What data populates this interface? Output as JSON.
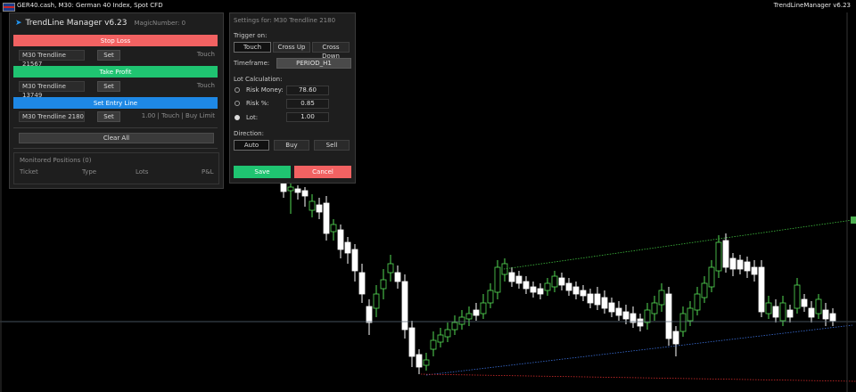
{
  "topbar": {
    "symbol": "GER40.cash, M30:  German 40 Index, Spot CFD",
    "version": "TrendLineManager v6.23"
  },
  "manager": {
    "title": "TrendLine Manager v6.23",
    "magic": "MagicNumber: 0",
    "stop_loss": {
      "label": "Stop Loss",
      "line": "M30 Trendline 21567",
      "set": "Set",
      "mode": "Touch",
      "color": "#f26262"
    },
    "take_profit": {
      "label": "Take Profit",
      "line": "M30 Trendline 13749",
      "set": "Set",
      "mode": "Touch",
      "color": "#1fc471"
    },
    "entry": {
      "label": "Set Entry Line",
      "line": "M30 Trendline 2180",
      "set": "Set",
      "info": "1.00 | Touch | Buy Limit",
      "color": "#1e88e5"
    },
    "clear_all": "Clear All",
    "monitored": {
      "title": "Monitored Positions (0)",
      "columns": [
        "Ticket",
        "Type",
        "Lots",
        "P&L"
      ]
    }
  },
  "settings": {
    "title": "Settings for: M30 Trendline 2180",
    "trigger_label": "Trigger on:",
    "triggers": [
      "Touch",
      "Cross Up",
      "Cross Down"
    ],
    "trigger_selected": 0,
    "timeframe_label": "Timeframe:",
    "timeframe": "PERIOD_H1",
    "lot_label": "Lot Calculation:",
    "lot_options": [
      {
        "label": "Risk Money:",
        "value": "78.60"
      },
      {
        "label": "Risk %:",
        "value": "0.85"
      },
      {
        "label": "Lot:",
        "value": "1.00"
      }
    ],
    "lot_selected": 2,
    "direction_label": "Direction:",
    "directions": [
      "Auto",
      "Buy",
      "Sell"
    ],
    "direction_selected": 0,
    "save": "Save",
    "cancel": "Cancel",
    "save_color": "#1fc471",
    "cancel_color": "#f26262"
  },
  "chart": {
    "background": "#000000",
    "bull_color": "#55dd55",
    "bear_color": "#ffffff",
    "upper_line_color": "#3fbf3f",
    "lower_line_color": "#3a6fd8",
    "red_line_color": "#d22b2b",
    "horizontal_line_color": "#5a6a7a",
    "edge_label_color": "#4caf50"
  }
}
